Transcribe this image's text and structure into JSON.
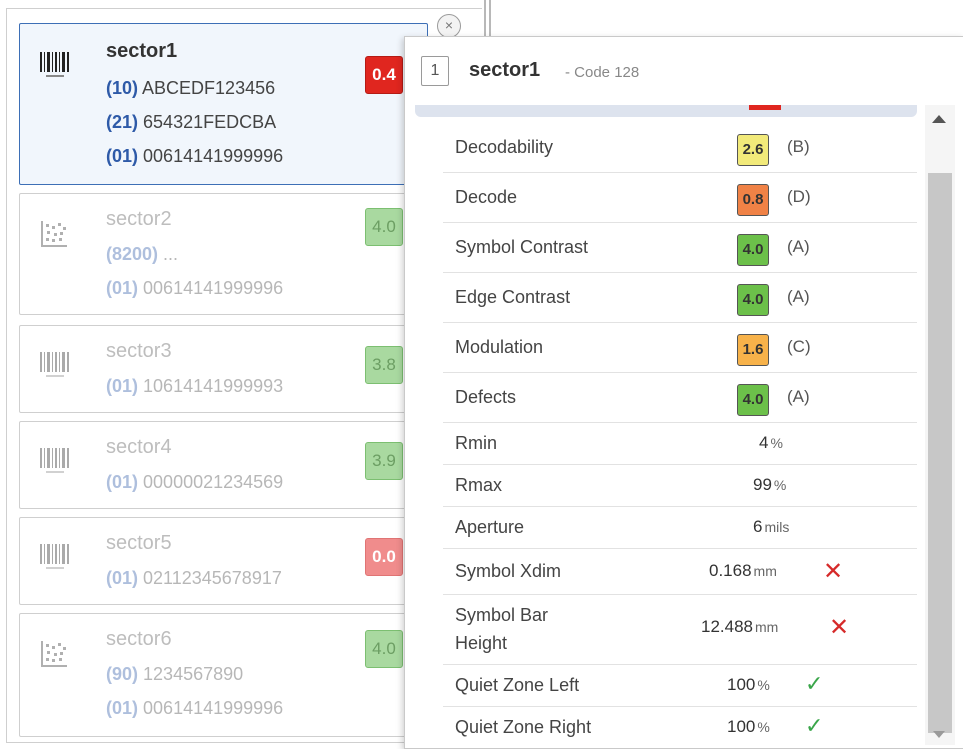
{
  "sectors": [
    {
      "name": "sector1",
      "grade": "0.4",
      "grade_color": "#e0261f",
      "icon": "barcode-1d-icon",
      "lines": [
        {
          "ai": "(10)",
          "value": "ABCEDF123456"
        },
        {
          "ai": "(21)",
          "value": "654321FEDCBA"
        },
        {
          "ai": "(01)",
          "value": "00614141999996"
        }
      ]
    },
    {
      "name": "sector2",
      "grade": "4.0",
      "grade_color": "#a9d9a0",
      "icon": "datamatrix-icon",
      "lines": [
        {
          "ai": "(8200)",
          "value": "..."
        },
        {
          "ai": "(01)",
          "value": "00614141999996"
        }
      ]
    },
    {
      "name": "sector3",
      "grade": "3.8",
      "grade_color": "#a9d9a0",
      "icon": "barcode-1d-icon",
      "lines": [
        {
          "ai": "(01)",
          "value": "10614141999993"
        }
      ]
    },
    {
      "name": "sector4",
      "grade": "3.9",
      "grade_color": "#a9d9a0",
      "icon": "barcode-1d-icon",
      "lines": [
        {
          "ai": "(01)",
          "value": "00000021234569"
        }
      ]
    },
    {
      "name": "sector5",
      "grade": "0.0",
      "grade_color": "#f08c8c",
      "icon": "barcode-1d-icon",
      "lines": [
        {
          "ai": "(01)",
          "value": "02112345678917"
        }
      ]
    },
    {
      "name": "sector6",
      "grade": "4.0",
      "grade_color": "#a9d9a0",
      "icon": "datamatrix-icon",
      "lines": [
        {
          "ai": "(90)",
          "value": "1234567890"
        },
        {
          "ai": "(01)",
          "value": "00614141999996"
        }
      ]
    }
  ],
  "popup": {
    "index": "1",
    "name": "sector1",
    "code": "- Code 128",
    "rows": [
      {
        "label": "Decodability",
        "grade": "2.6",
        "letter": "(B)",
        "color": "#f2ea7a"
      },
      {
        "label": "Decode",
        "grade": "0.8",
        "letter": "(D)",
        "color": "#f08246"
      },
      {
        "label": "Symbol Contrast",
        "grade": "4.0",
        "letter": "(A)",
        "color": "#6cc04a"
      },
      {
        "label": "Edge Contrast",
        "grade": "4.0",
        "letter": "(A)",
        "color": "#6cc04a"
      },
      {
        "label": "Modulation",
        "grade": "1.6",
        "letter": "(C)",
        "color": "#f7b24a"
      },
      {
        "label": "Defects",
        "grade": "4.0",
        "letter": "(A)",
        "color": "#6cc04a"
      },
      {
        "label": "Rmin",
        "value": "4",
        "unit": "%"
      },
      {
        "label": "Rmax",
        "value": "99",
        "unit": "%"
      },
      {
        "label": "Aperture",
        "value": "6",
        "unit": "mils"
      },
      {
        "label": "Symbol Xdim",
        "value": "0.168",
        "unit": "mm",
        "status": "fail"
      },
      {
        "label": "Symbol Bar Height",
        "value": "12.488",
        "unit": "mm",
        "status": "fail"
      },
      {
        "label": "Quiet Zone Left",
        "value": "100",
        "unit": "%",
        "status": "pass"
      },
      {
        "label": "Quiet Zone Right",
        "value": "100",
        "unit": "%",
        "status": "pass"
      }
    ]
  }
}
